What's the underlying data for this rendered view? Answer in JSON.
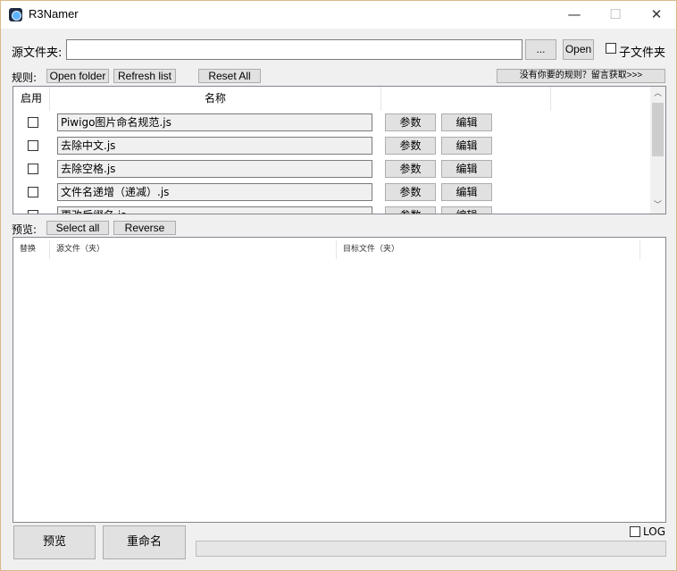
{
  "window": {
    "title": "R3Namer",
    "min_icon": "—",
    "max_icon": "☐",
    "close_icon": "✕"
  },
  "source": {
    "label": "源文件夹:",
    "value": "",
    "browse_label": "...",
    "open_label": "Open",
    "subfolder_label": "子文件夹",
    "subfolder_checked": false
  },
  "rules_toolbar": {
    "label": "规则:",
    "open_folder": "Open folder",
    "refresh_list": "Refresh list",
    "reset_all": "Reset All",
    "get_rules": "没有你要的规则？留言获取>>>"
  },
  "rules_grid": {
    "headers": {
      "enabled": "启用",
      "name": "名称"
    },
    "rows": [
      {
        "enabled": false,
        "name": "Piwigo图片命名规范.js",
        "params": "参数",
        "edit": "编辑"
      },
      {
        "enabled": false,
        "name": "去除中文.js",
        "params": "参数",
        "edit": "编辑"
      },
      {
        "enabled": false,
        "name": "去除空格.js",
        "params": "参数",
        "edit": "编辑"
      },
      {
        "enabled": false,
        "name": "文件名递增（递减）.js",
        "params": "参数",
        "edit": "编辑"
      },
      {
        "enabled": false,
        "name": "更改后缀名.js",
        "params": "参数",
        "edit": "编辑"
      }
    ],
    "scroll_up": "︿",
    "scroll_down": "﹀"
  },
  "preview_toolbar": {
    "label": "预览:",
    "select_all": "Select all",
    "reverse": "Reverse"
  },
  "preview_list": {
    "headers": {
      "replace": "替换",
      "source": "源文件（夹）",
      "target": "目标文件（夹）"
    }
  },
  "bottom": {
    "preview_button": "预览",
    "rename_button": "重命名",
    "log_label": "LOG",
    "log_checked": false,
    "progress_percent": 0
  }
}
